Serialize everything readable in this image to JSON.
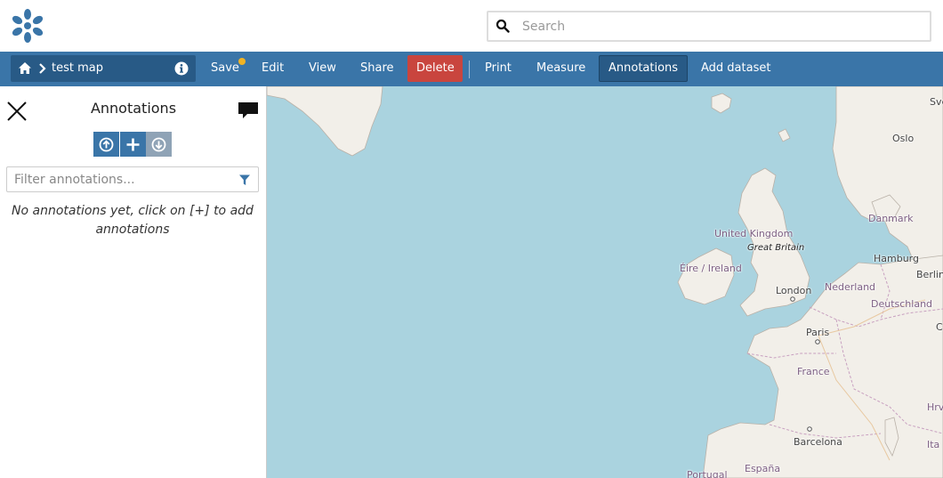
{
  "search": {
    "placeholder": "Search",
    "value": ""
  },
  "header": {
    "map_title": "test map",
    "menu": {
      "save": "Save",
      "edit": "Edit",
      "view": "View",
      "share": "Share",
      "delete": "Delete",
      "print": "Print",
      "measure": "Measure",
      "annotations": "Annotations",
      "add_dataset": "Add dataset"
    }
  },
  "panel": {
    "title": "Annotations",
    "filter_placeholder": "Filter annotations...",
    "empty_message": "No annotations yet, click on [+] to add annotations"
  },
  "map": {
    "labels": {
      "oslo": "Oslo",
      "sve": "Sve",
      "danmark": "Danmark",
      "united_kingdom": "United Kingdom",
      "great_britain": "Great Britain",
      "eire": "Éire / Ireland",
      "hamburg": "Hamburg",
      "berlin": "Berlin",
      "london": "London",
      "nederland": "Nederland",
      "deutschland": "Deutschland",
      "paris": "Paris",
      "france": "France",
      "barcelona": "Barcelona",
      "espana": "España",
      "portugal": "Portugal",
      "hrv": "Hrv",
      "ita": "Ita",
      "c": "C"
    }
  },
  "colors": {
    "brand_blue": "#3a75a8",
    "dark_blue": "#285a86",
    "delete_red": "#c9453e",
    "unsaved_dot": "#f0b323",
    "sea": "#aad3df",
    "land": "#f2efe9"
  }
}
